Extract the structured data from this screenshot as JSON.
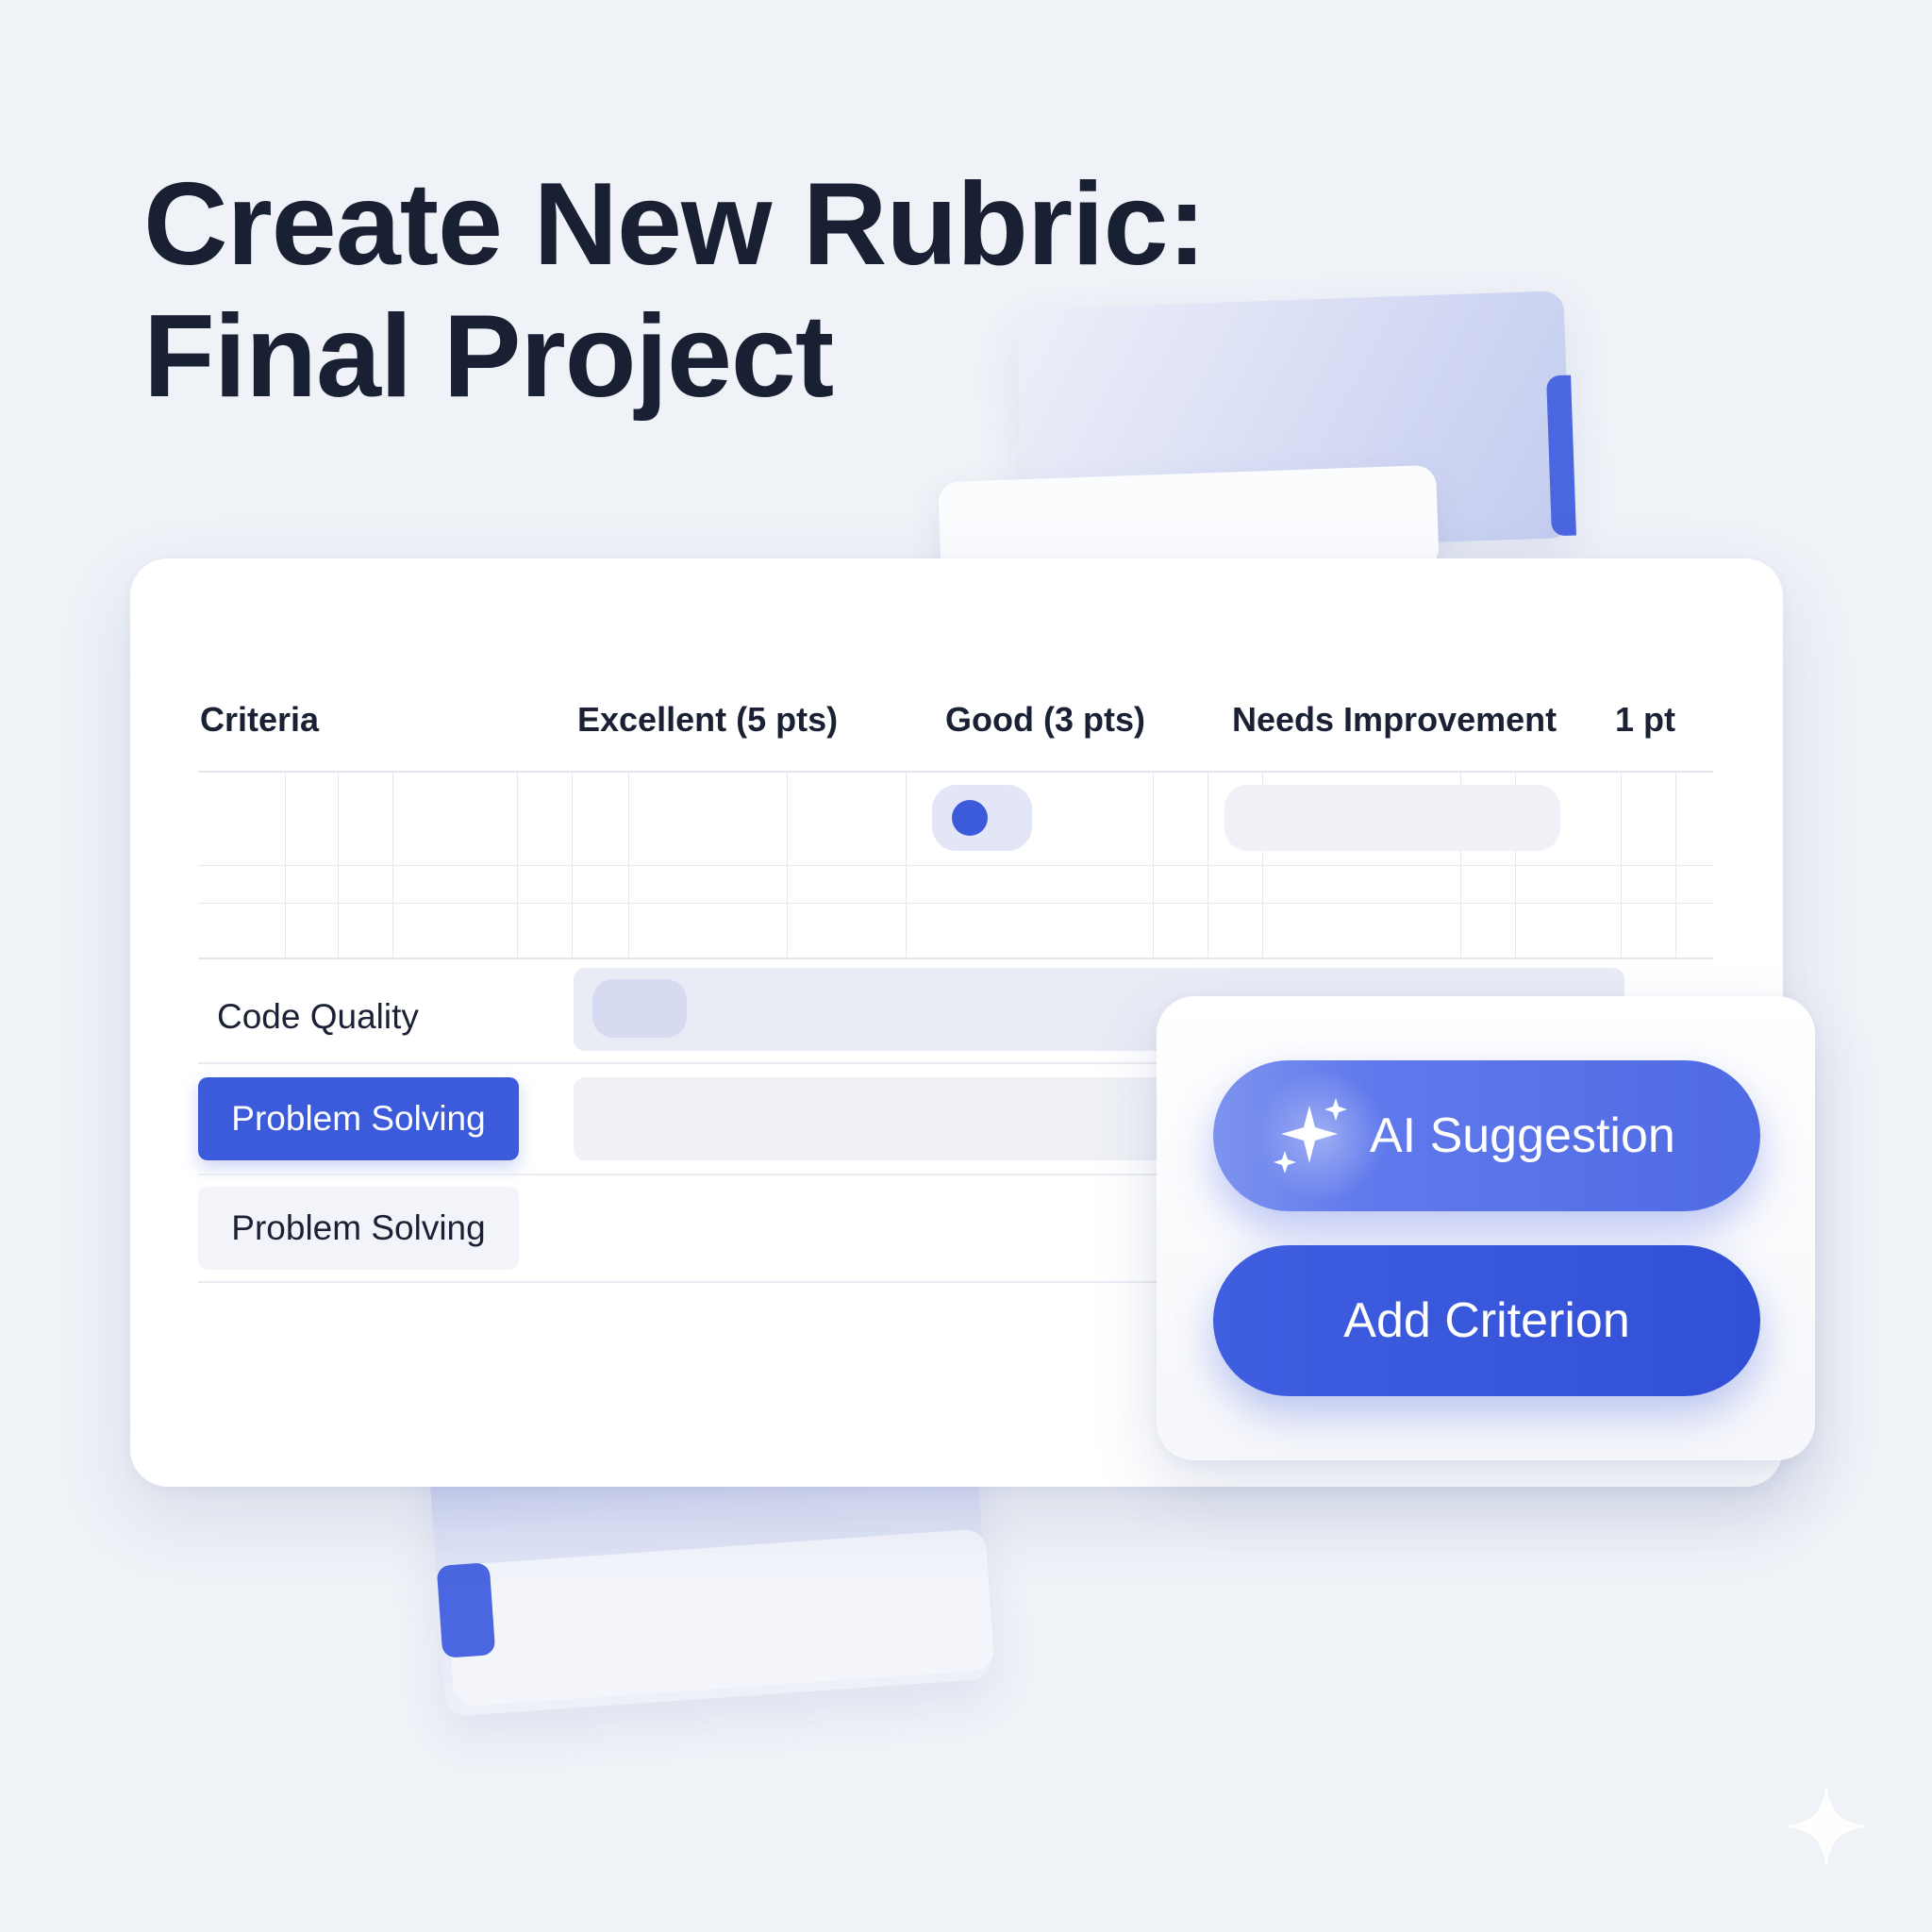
{
  "page": {
    "title_line1": "Create New Rubric:",
    "title_line2": "Final Project"
  },
  "rubric": {
    "columns": [
      "Criteria",
      "Excellent (5 pts)",
      "Good (3 pts)",
      "Needs Improvement",
      "1 pt"
    ],
    "toggle_on": true,
    "criteria": [
      {
        "label": "Code Quality",
        "selected": false
      },
      {
        "label": "Problem Solving",
        "selected": true
      },
      {
        "label": "Problem Solving",
        "selected": false
      }
    ]
  },
  "actions": {
    "ai_suggestion_label": "AI Suggestion",
    "add_criterion_label": "Add Criterion"
  },
  "icons": {
    "ai_button_icon": "sparkle-icon",
    "toggle": "toggle-dot",
    "corner": "sparkle-icon"
  },
  "colors": {
    "accent": "#3b5bdb",
    "title": "#1a2033",
    "background": "#eff2f7"
  }
}
